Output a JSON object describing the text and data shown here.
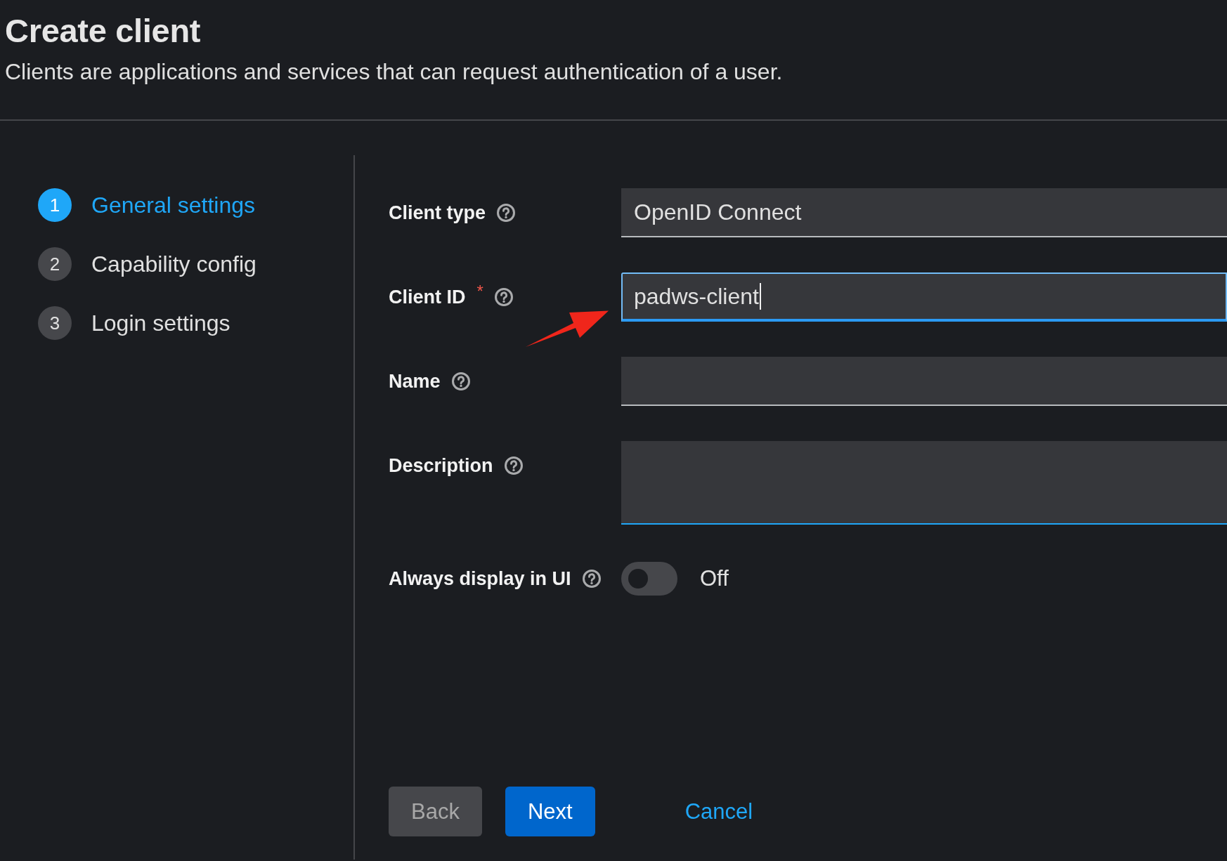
{
  "header": {
    "title": "Create client",
    "description": "Clients are applications and services that can request authentication of a user."
  },
  "steps": [
    {
      "number": "1",
      "label": "General settings",
      "selected": true
    },
    {
      "number": "2",
      "label": "Capability config",
      "selected": false
    },
    {
      "number": "3",
      "label": "Login settings",
      "selected": false
    }
  ],
  "fields": [
    {
      "kind": "select",
      "label": "Client type",
      "value": "OpenID Connect",
      "focused": false
    },
    {
      "kind": "text",
      "label": "Client ID",
      "required_mark": "*",
      "value": "padws-client",
      "focused": true
    },
    {
      "kind": "text",
      "label": "Name",
      "focused": false
    },
    {
      "kind": "textarea",
      "label": "Description",
      "focused": false
    },
    {
      "kind": "switch",
      "label": "Always display in UI",
      "on": false,
      "state_label": "Off"
    }
  ],
  "buttons": [
    {
      "kind": "secondary",
      "label": "Back",
      "disabled": true
    },
    {
      "kind": "primary",
      "label": "Next",
      "disabled": false
    },
    {
      "kind": "link",
      "label": "Cancel",
      "disabled": false
    }
  ]
}
